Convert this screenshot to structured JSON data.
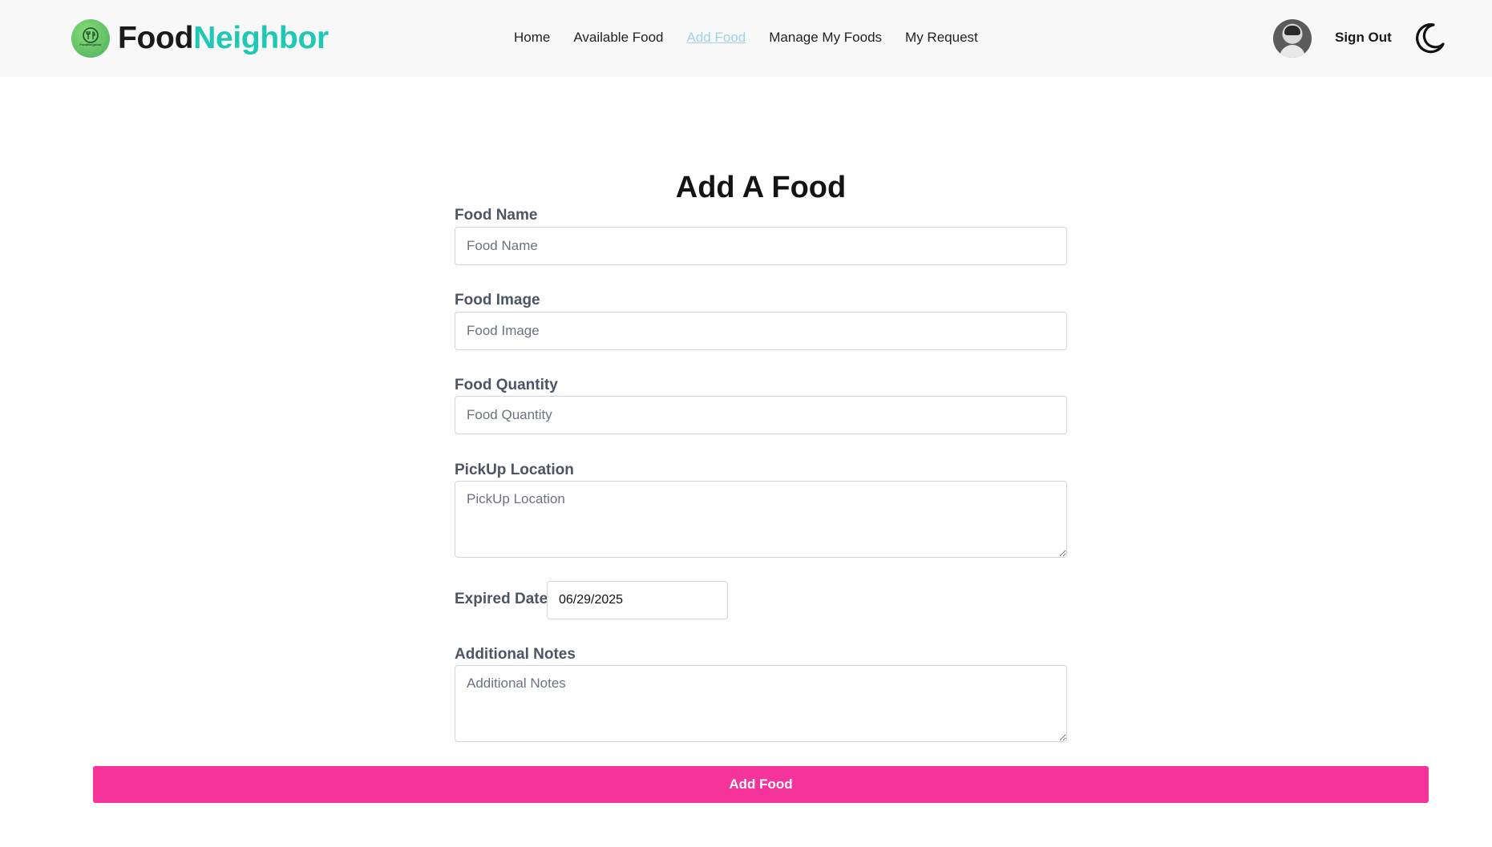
{
  "brand": {
    "part1": "Food",
    "part2": "Neighbor",
    "badge_text": "FoodNeighbor"
  },
  "nav": {
    "items": [
      {
        "label": "Home",
        "active": false
      },
      {
        "label": "Available Food",
        "active": false
      },
      {
        "label": "Add Food",
        "active": true
      },
      {
        "label": "Manage My Foods",
        "active": false
      },
      {
        "label": "My Request",
        "active": false
      }
    ],
    "sign_out": "Sign Out"
  },
  "page": {
    "title": "Add A Food"
  },
  "form": {
    "food_name": {
      "label": "Food Name",
      "placeholder": "Food Name",
      "value": ""
    },
    "food_image": {
      "label": "Food Image",
      "placeholder": "Food Image",
      "value": ""
    },
    "food_quantity": {
      "label": "Food Quantity",
      "placeholder": "Food Quantity",
      "value": ""
    },
    "pickup_location": {
      "label": "PickUp Location",
      "placeholder": "PickUp Location",
      "value": ""
    },
    "expired_date": {
      "label": "Expired Date",
      "value": "06/29/2025"
    },
    "additional_notes": {
      "label": "Additional Notes",
      "placeholder": "Additional Notes",
      "value": ""
    },
    "submit_label": "Add Food"
  },
  "colors": {
    "brand_accent": "#1ec8b4",
    "active_link": "#9fd3e3",
    "submit_button": "#f6339a",
    "navbar_bg": "#f8f8f8"
  },
  "icons": {
    "logo": "leaf-plate-icon",
    "theme_toggle": "moon-icon"
  }
}
